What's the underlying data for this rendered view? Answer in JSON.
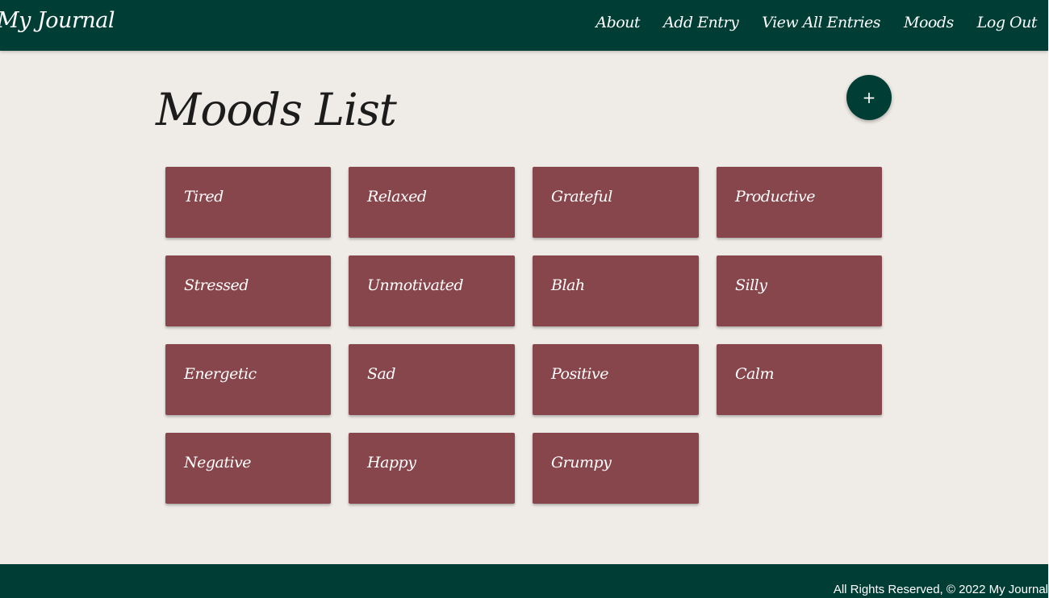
{
  "navbar": {
    "brand": "My Journal",
    "links": [
      "About",
      "Add Entry",
      "View All Entries",
      "Moods",
      "Log Out"
    ]
  },
  "main": {
    "title": "Moods List",
    "add_button_label": "+",
    "moods": [
      "Tired",
      "Relaxed",
      "Grateful",
      "Productive",
      "Stressed",
      "Unmotivated",
      "Blah",
      "Silly",
      "Energetic",
      "Sad",
      "Positive",
      "Calm",
      "Negative",
      "Happy",
      "Grumpy"
    ]
  },
  "footer": {
    "text": "All Rights Reserved, © 2022 My Journal"
  },
  "colors": {
    "header_footer": "#003e35",
    "page_background": "#efebe6",
    "mood_card": "#87454c",
    "text_on_dark": "#ffffff",
    "title_text": "#1c1c1c"
  }
}
